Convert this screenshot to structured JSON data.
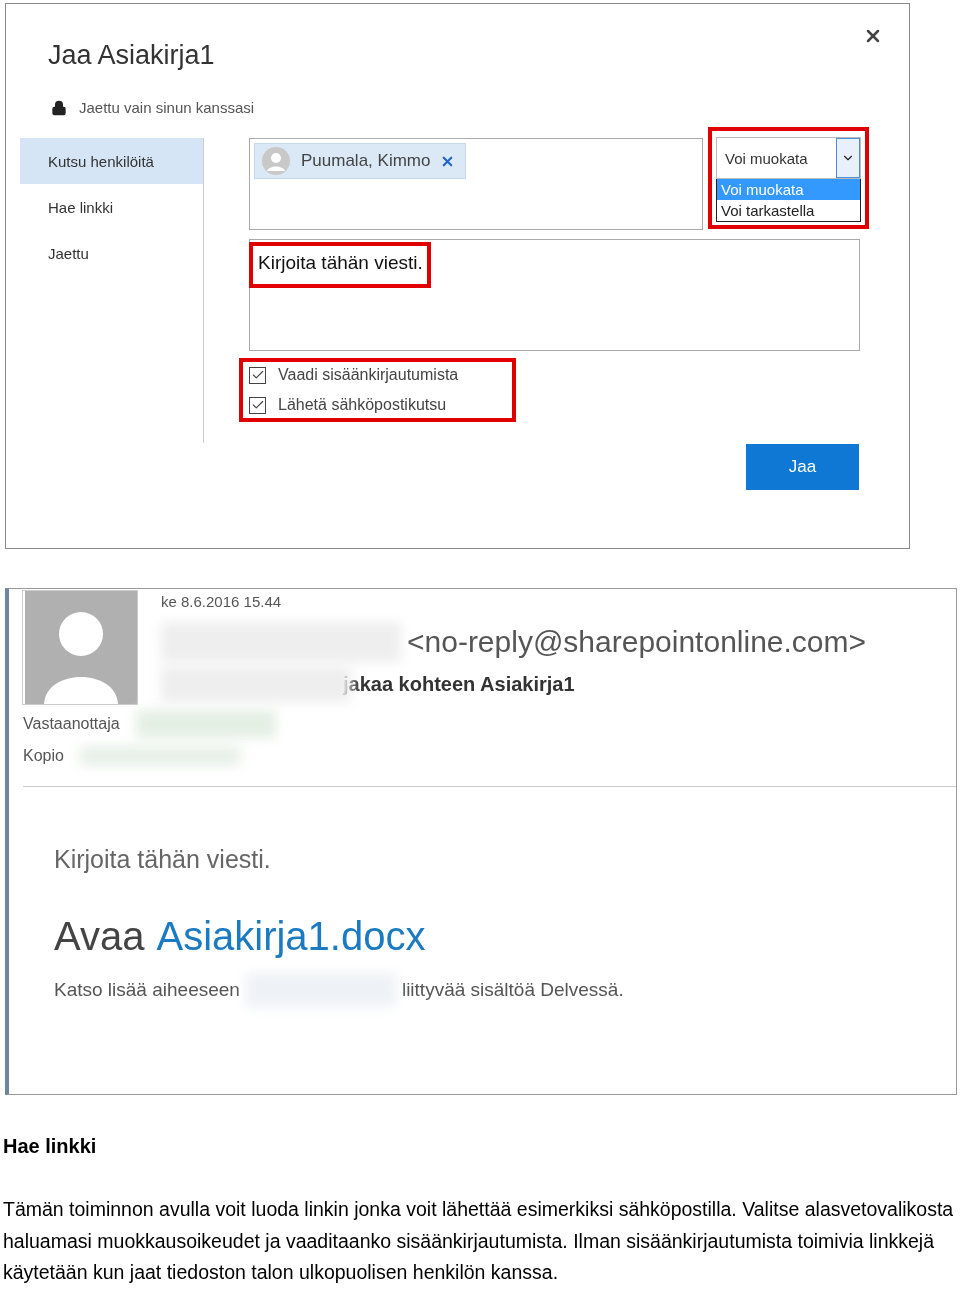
{
  "share_dialog": {
    "title": "Jaa Asiakirja1",
    "status": "Jaettu vain sinun kanssasi",
    "nav": [
      {
        "label": "Kutsu henkilöitä",
        "selected": true
      },
      {
        "label": "Hae linkki",
        "selected": false
      },
      {
        "label": "Jaettu",
        "selected": false
      }
    ],
    "recipient": "Puumala, Kimmo",
    "permission": {
      "value": "Voi muokata",
      "options": [
        {
          "label": "Voi muokata",
          "selected": true
        },
        {
          "label": "Voi tarkastella",
          "selected": false
        }
      ]
    },
    "message_placeholder": "Kirjoita tähän viesti.",
    "options": [
      {
        "label": "Vaadi sisäänkirjautumista",
        "checked": true
      },
      {
        "label": "Lähetä sähköpostikutsu",
        "checked": true
      }
    ],
    "button": "Jaa"
  },
  "email": {
    "date": "ke 8.6.2016 15.44",
    "sender_address": "<no-reply@sharepointonline.com>",
    "subject": "jakaa kohteen Asiakirja1",
    "to_label": "Vastaanottaja",
    "cc_label": "Kopio",
    "message": "Kirjoita tähän viesti.",
    "open_prefix": "Avaa",
    "open_link": "Asiakirja1.docx",
    "more_before": "Katso lisää aiheeseen",
    "more_after": "liittyvää sisältöä Delvessä."
  },
  "section": {
    "heading": "Hae linkki",
    "paragraph": "Tämän toiminnon avulla voit luoda linkin jonka voit lähettää esimerkiksi sähköpostilla. Valitse alasvetovalikosta haluamasi muokkausoikeudet ja vaaditaanko sisäänkirjautumista. Ilman sisäänkirjautumista toimivia linkkejä käytetään kun jaat tiedoston talon ulkopuolisen henkilön kanssa."
  }
}
